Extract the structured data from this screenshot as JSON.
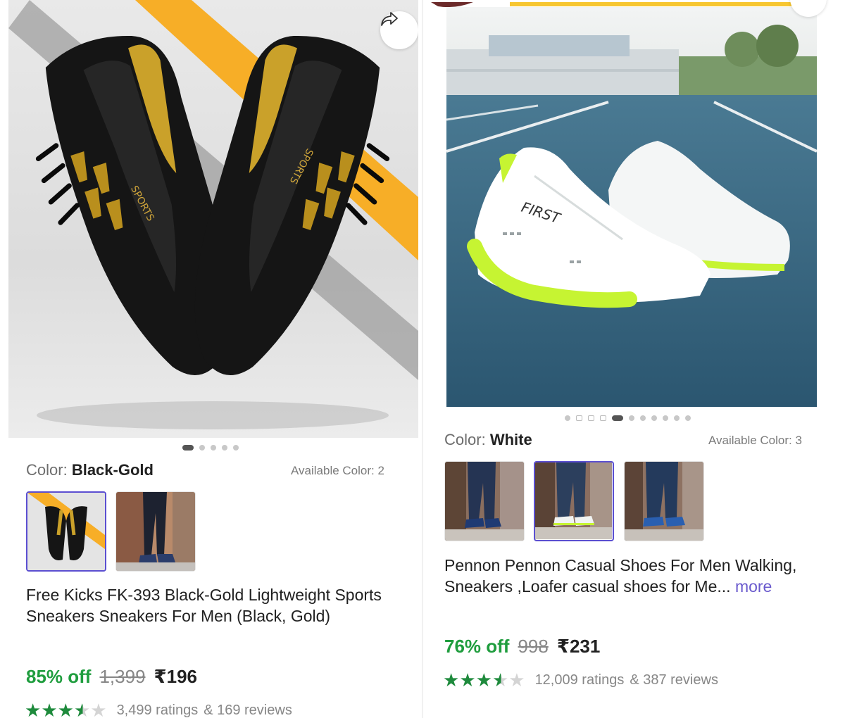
{
  "left": {
    "color_label": "Color:",
    "color_value": "Black-Gold",
    "available": "Available Color: 2",
    "title": "Free Kicks FK-393 Black-Gold Lightweight Sports Sneakers Sneakers For Men (Black, Gold)",
    "discount": "85% off",
    "mrp": "1,399",
    "price": "₹196",
    "ratings": "3,499 ratings",
    "reviews": "& 169 reviews",
    "rating_value": 3.5,
    "image_count": 5,
    "active_image": 1,
    "shoe_print": "SPORTS"
  },
  "right": {
    "color_label": "Color:",
    "color_value": "White",
    "available": "Available Color: 3",
    "title": "Pennon Pennon Casual Shoes For Men Walking, Sneakers ,Loafer casual shoes for Me...",
    "more": "more",
    "discount": "76% off",
    "mrp": "998",
    "price": "₹231",
    "ratings": "12,009 ratings",
    "reviews": "& 387 reviews",
    "rating_value": 3.5,
    "image_count": 11,
    "active_image": 5,
    "shoe_brand": "FIRST"
  },
  "icons": {
    "share": "share-icon",
    "star": "star-icon"
  },
  "colors": {
    "accent": "#5b4fd1",
    "discount_green": "#1f9d3e",
    "star_green": "#1e8a3c",
    "gold": "#c9a227",
    "neon": "#c6f432"
  }
}
